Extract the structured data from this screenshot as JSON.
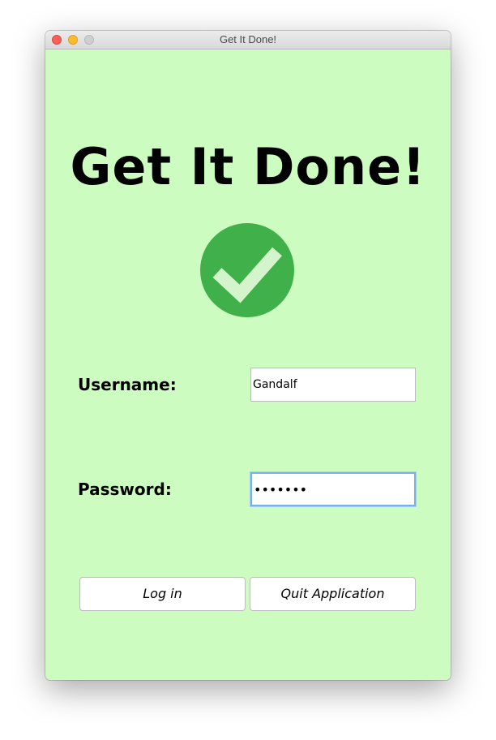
{
  "window": {
    "title": "Get It Done!",
    "controls": [
      "close",
      "minimize",
      "zoom"
    ]
  },
  "app": {
    "heading": "Get It Done!",
    "logo_icon": "checkmark-circle-icon",
    "accent_color": "#40b04a",
    "background_color": "#cdfcc0"
  },
  "form": {
    "username_label": "Username:",
    "username_value": "Gandalf",
    "password_label": "Password:",
    "password_value": "•••••••"
  },
  "buttons": {
    "login_label": "Log in",
    "quit_label": "Quit Application"
  }
}
